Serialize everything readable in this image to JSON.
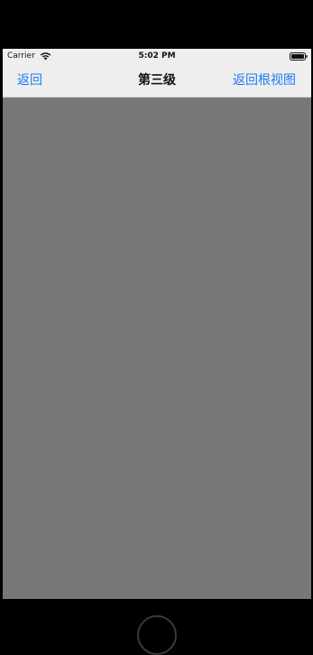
{
  "status_bar": {
    "carrier": "Carrier",
    "time": "5:02 PM",
    "wifi_icon": "wifi-icon",
    "battery_icon": "battery-icon"
  },
  "nav_bar": {
    "back_label": "返回",
    "title": "第三级",
    "root_label": "返回根视图"
  },
  "colors": {
    "accent": "#1a7cf0",
    "bar_background": "#eeeeee",
    "content_background": "#777777"
  }
}
